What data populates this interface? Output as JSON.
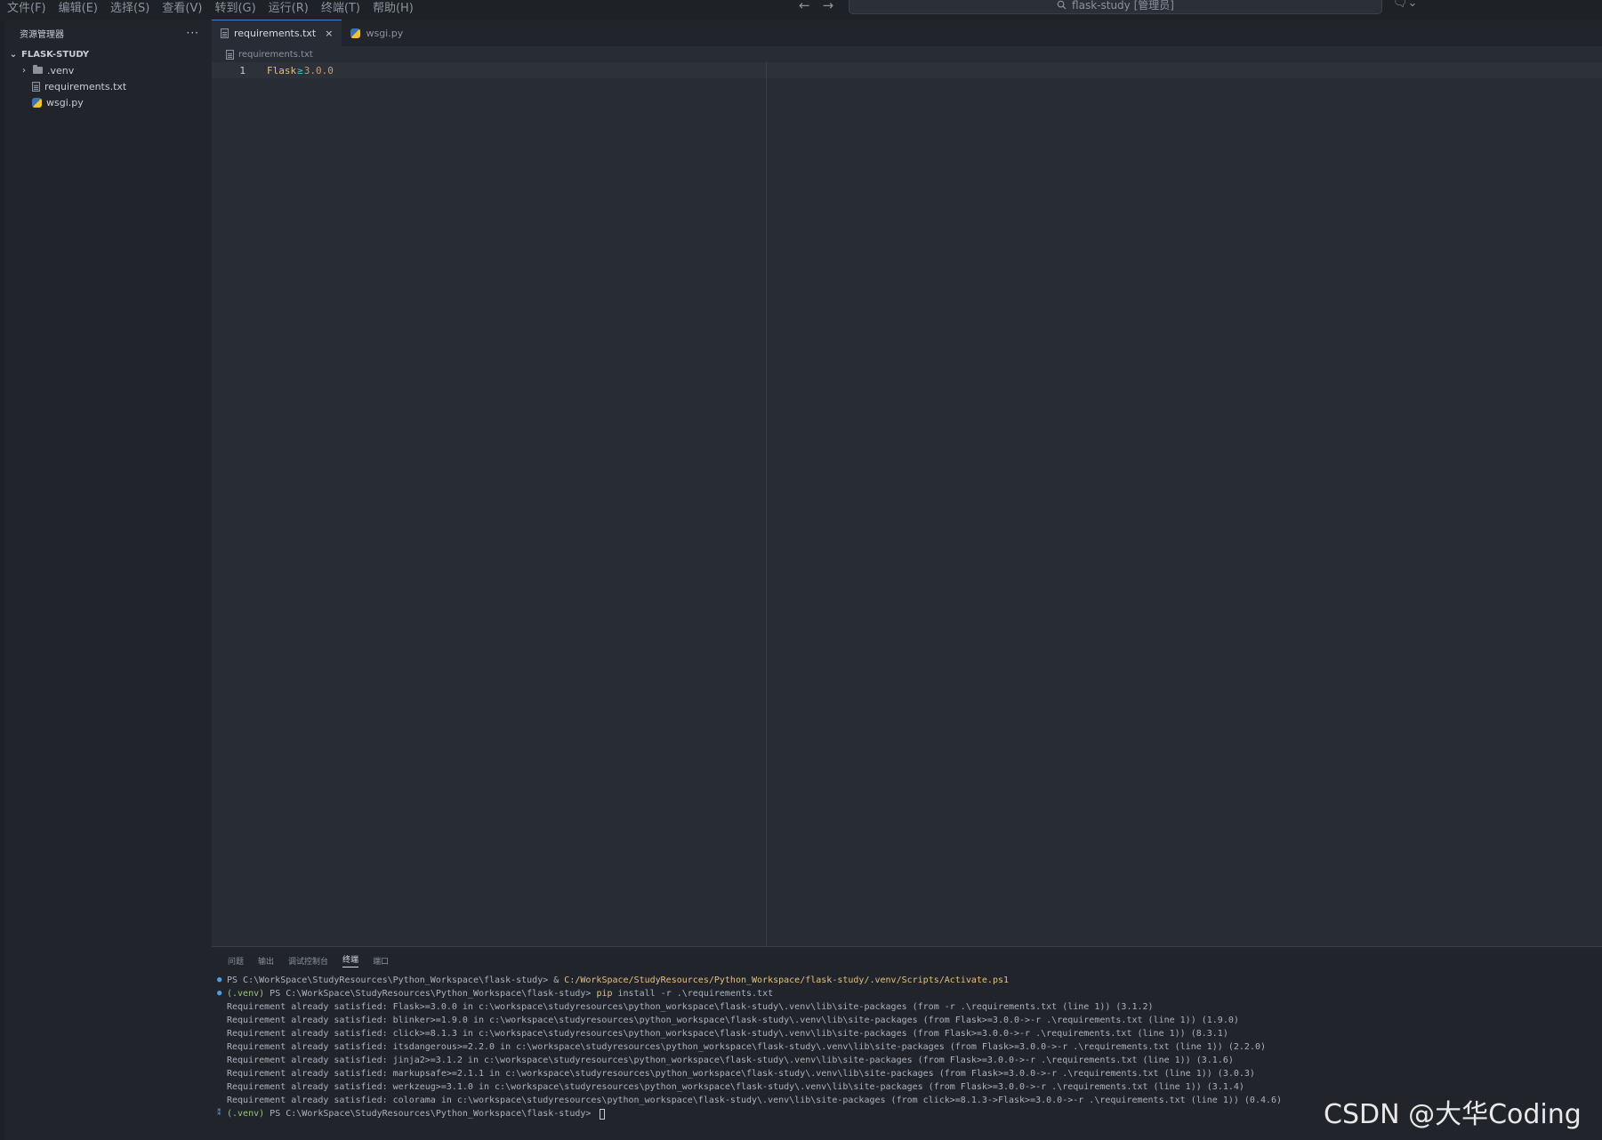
{
  "menu": [
    "文件(F)",
    "编辑(E)",
    "选择(S)",
    "查看(V)",
    "转到(G)",
    "运行(R)",
    "终端(T)",
    "帮助(H)"
  ],
  "command_center": {
    "text": "flask-study [管理员]"
  },
  "sidebar": {
    "title": "资源管理器",
    "more": "···",
    "section": "FLASK-STUDY",
    "items": [
      {
        "label": ".venv",
        "type": "folder"
      },
      {
        "label": "requirements.txt",
        "type": "text-file"
      },
      {
        "label": "wsgi.py",
        "type": "python-file"
      }
    ]
  },
  "tabs": [
    {
      "label": "requirements.txt",
      "active": true,
      "close": "×"
    },
    {
      "label": "wsgi.py",
      "active": false
    }
  ],
  "breadcrumb": "requirements.txt",
  "editor": {
    "line_number": "1",
    "tokens": {
      "name": "Flask",
      "op": "≥",
      "version": "3.0.0"
    }
  },
  "panel": {
    "tabs": [
      "问题",
      "输出",
      "调试控制台",
      "终端",
      "端口"
    ],
    "active_tab": "终端",
    "terminal": {
      "line1_prompt": "PS C:\\WorkSpace\\StudyResources\\Python_Workspace\\flask-study> & ",
      "line1_path": "C:/WorkSpace/StudyResources/Python_Workspace/flask-study/.venv/Scripts/Activate.ps1",
      "line2_venv": "(.venv)",
      "line2_prompt": " PS C:\\WorkSpace\\StudyResources\\Python_Workspace\\flask-study> ",
      "line2_cmd": "pip",
      "line2_args": " install -r .\\requirements.txt",
      "output": [
        "Requirement already satisfied: Flask>=3.0.0 in c:\\workspace\\studyresources\\python_workspace\\flask-study\\.venv\\lib\\site-packages (from -r .\\requirements.txt (line 1)) (3.1.2)",
        "Requirement already satisfied: blinker>=1.9.0 in c:\\workspace\\studyresources\\python_workspace\\flask-study\\.venv\\lib\\site-packages (from Flask>=3.0.0->-r .\\requirements.txt (line 1)) (1.9.0)",
        "Requirement already satisfied: click>=8.1.3 in c:\\workspace\\studyresources\\python_workspace\\flask-study\\.venv\\lib\\site-packages (from Flask>=3.0.0->-r .\\requirements.txt (line 1)) (8.3.1)",
        "Requirement already satisfied: itsdangerous>=2.2.0 in c:\\workspace\\studyresources\\python_workspace\\flask-study\\.venv\\lib\\site-packages (from Flask>=3.0.0->-r .\\requirements.txt (line 1)) (2.2.0)",
        "Requirement already satisfied: jinja2>=3.1.2 in c:\\workspace\\studyresources\\python_workspace\\flask-study\\.venv\\lib\\site-packages (from Flask>=3.0.0->-r .\\requirements.txt (line 1)) (3.1.6)",
        "Requirement already satisfied: markupsafe>=2.1.1 in c:\\workspace\\studyresources\\python_workspace\\flask-study\\.venv\\lib\\site-packages (from Flask>=3.0.0->-r .\\requirements.txt (line 1)) (3.0.3)",
        "Requirement already satisfied: werkzeug>=3.1.0 in c:\\workspace\\studyresources\\python_workspace\\flask-study\\.venv\\lib\\site-packages (from Flask>=3.0.0->-r .\\requirements.txt (line 1)) (3.1.4)",
        "Requirement already satisfied: colorama in c:\\workspace\\studyresources\\python_workspace\\flask-study\\.venv\\lib\\site-packages (from click>=8.1.3->Flask>=3.0.0->-r .\\requirements.txt (line 1)) (0.4.6)"
      ],
      "last_venv": "(.venv)",
      "last_prompt": " PS C:\\WorkSpace\\StudyResources\\Python_Workspace\\flask-study> "
    }
  },
  "watermark": "CSDN @大华Coding",
  "colors": {
    "accent": "#4d78cc",
    "background": "#282c34",
    "sidebar": "#21252b"
  }
}
